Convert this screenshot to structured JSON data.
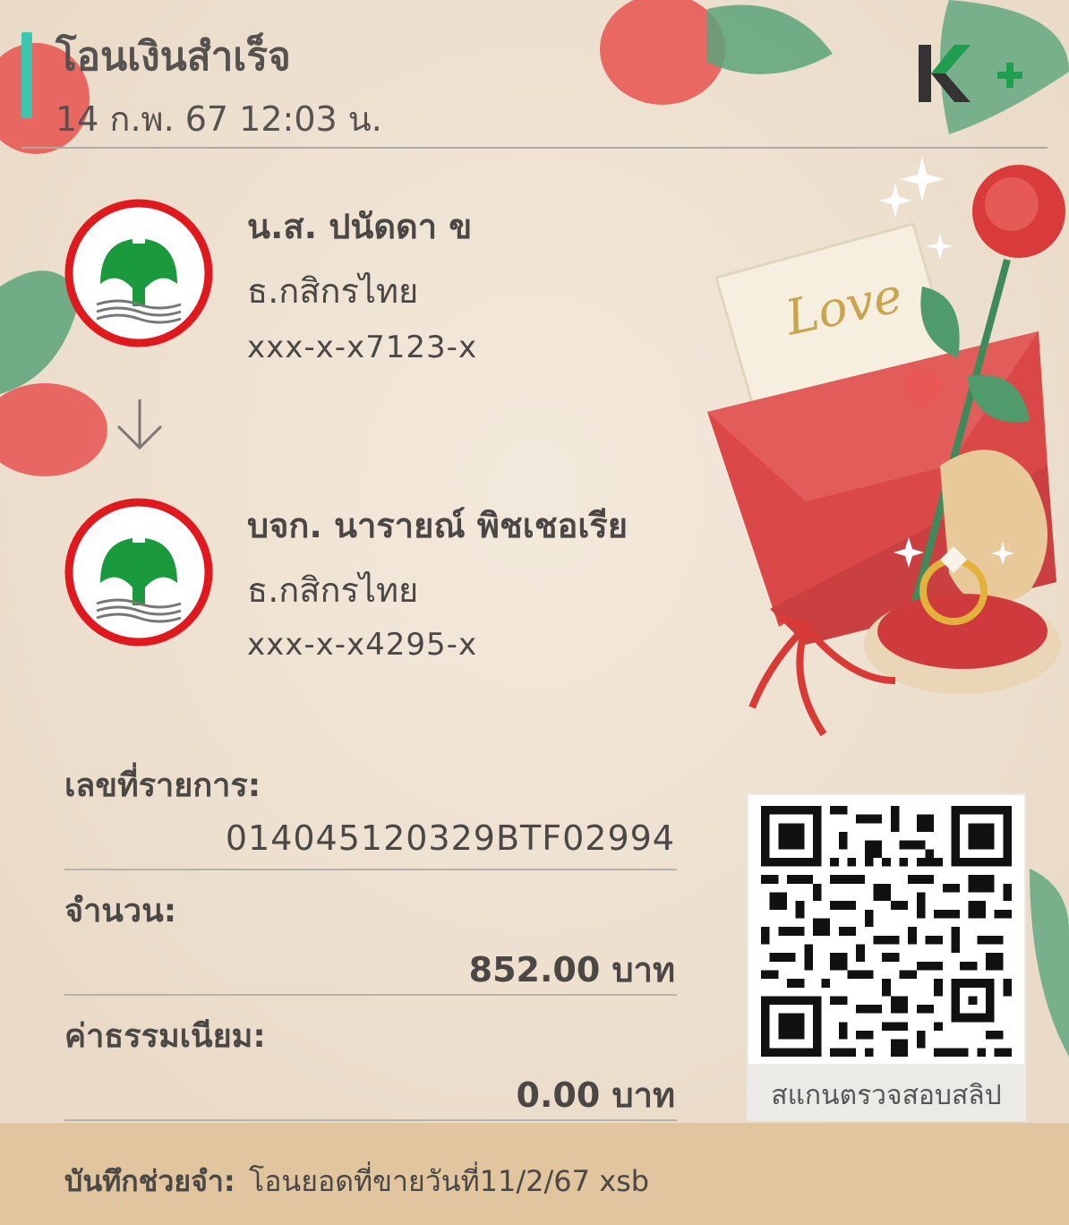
{
  "header": {
    "title": "โอนเงินสำเร็จ",
    "datetime": "14 ก.พ. 67  12:03 น.",
    "logo_text": "K+"
  },
  "sender": {
    "name": "น.ส. ปนัดดา ข",
    "bank": "ธ.กสิกรไทย",
    "account": "xxx-x-x7123-x",
    "logo": "kbank-logo"
  },
  "receiver": {
    "name": "บจก. นารายณ์ พิชเชอเรีย",
    "bank": "ธ.กสิกรไทย",
    "account": "xxx-x-x4295-x",
    "logo": "kbank-logo"
  },
  "transaction": {
    "ref_label": "เลขที่รายการ:",
    "ref_value": "014045120329BTF02994",
    "amount_label": "จำนวน:",
    "amount_value": "852.00 บาท",
    "fee_label": "ค่าธรรมเนียม:",
    "fee_value": "0.00 บาท"
  },
  "qr": {
    "caption": "สแกนตรวจสอบสลิป",
    "icon": "qr-code-icon"
  },
  "memo": {
    "label": "บันทึกช่วยจำ:",
    "text": "โอนยอดที่ขายวันที่11/2/67 xsb"
  },
  "colors": {
    "accent": "#3cc6b0",
    "background": "#efe3d3",
    "memo_bar": "#e0c59e",
    "kbank_green": "#1a9a3c",
    "kbank_red": "#e0191f"
  },
  "illustration": {
    "love_text": "Love"
  }
}
